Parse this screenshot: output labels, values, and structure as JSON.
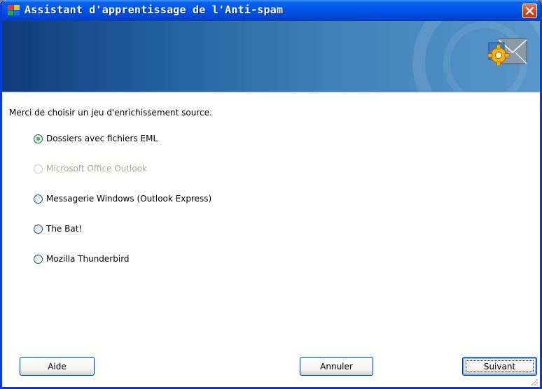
{
  "window": {
    "title": "Assistant d'apprentissage de l'Anti-spam",
    "close_icon": "close-icon",
    "app_icon": "avg-app-icon",
    "banner_logo": "envelope-gear-logo"
  },
  "content": {
    "instruction": "Merci de choisir un jeu d'enrichissement source.",
    "options": [
      {
        "label": "Dossiers avec fichiers EML",
        "selected": true,
        "enabled": true
      },
      {
        "label": "Microsoft Office Outlook",
        "selected": false,
        "enabled": false
      },
      {
        "label": "Messagerie Windows (Outlook Express)",
        "selected": false,
        "enabled": true
      },
      {
        "label": "The Bat!",
        "selected": false,
        "enabled": true
      },
      {
        "label": "Mozilla Thunderbird",
        "selected": false,
        "enabled": true
      }
    ]
  },
  "buttons": {
    "help": "Aide",
    "cancel": "Annuler",
    "next": "Suivant"
  },
  "colors": {
    "titlebar": "#0058ee",
    "banner_left": "#103a7c",
    "banner_right": "#5a96c9",
    "radio_selected": "#21a121",
    "disabled_text": "#aca899"
  }
}
